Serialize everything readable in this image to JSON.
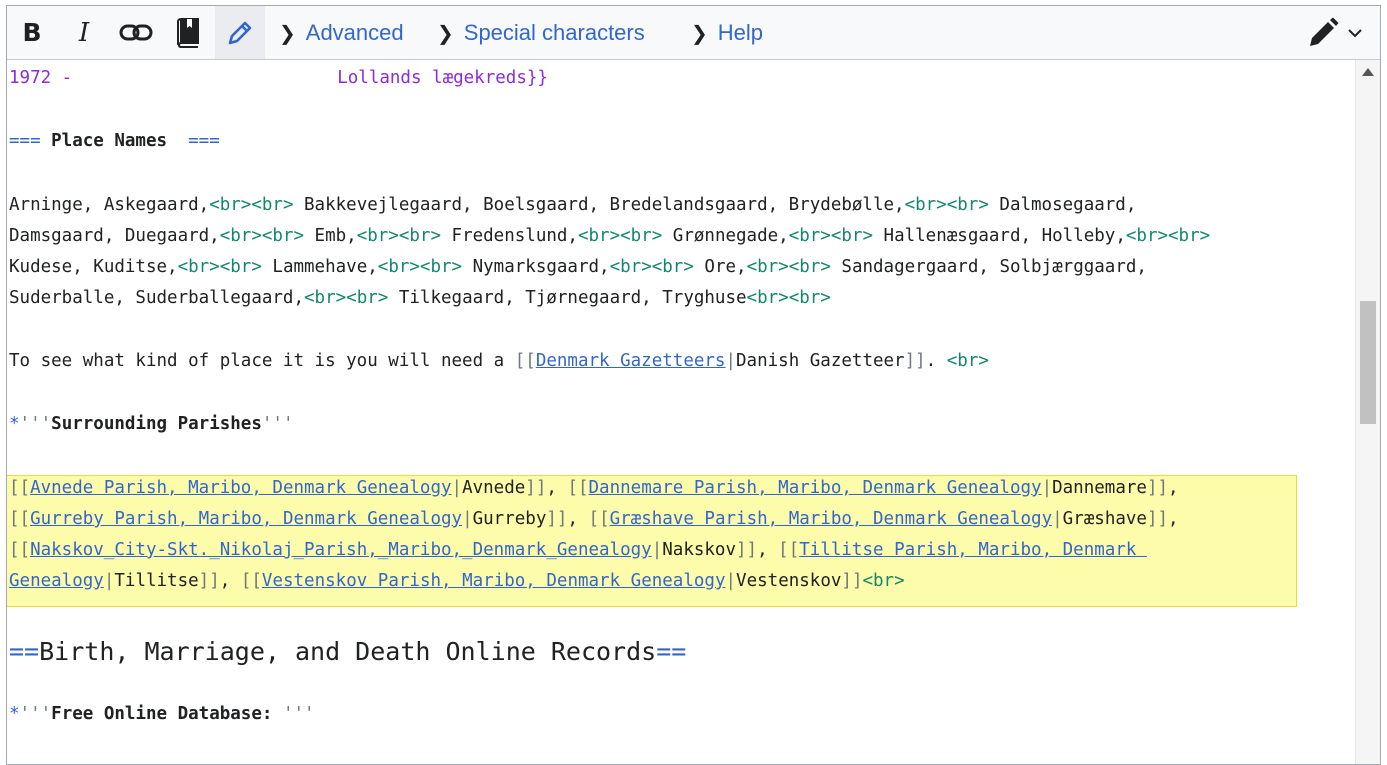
{
  "toolbar": {
    "bold": "B",
    "italic": "I",
    "tabs": [
      "Advanced",
      "Special characters",
      "Help"
    ]
  },
  "editor": {
    "line1_year": "1972 -",
    "line1_rest": "Lollands lægekreds}}",
    "section_eq": "===",
    "section_title": " Place Names  ",
    "p1": {
      "a": "Arninge, Askegaard,",
      "b": " Bakkevejlegaard, Boelsgaard, Bredelandsgaard, Brydebølle,",
      "c": " Dalmosegaard,",
      "d": "Damsgaard, Duegaard,",
      "e": " Emb,",
      "f": " Fredenslund,",
      "g": " Grønnegade,",
      "h": " Hallenæsgaard, Holleby,",
      "i": "Kudese, Kuditse,",
      "j": " Lammehave,",
      "k": " Nymarksgaard,",
      "l": " Ore,",
      "m": " Sandagergaard, Solbjærggaard,",
      "n": "Suderballe, Suderballegaard,",
      "o": " Tilkegaard, Tjørnegaard, Tryghuse"
    },
    "brbr": "<br><br>",
    "br": "<br>",
    "gaz": {
      "before": "To see what kind of place it is you will need a ",
      "open": "[[",
      "link": "Denmark Gazetteers",
      "pipe": "|",
      "label": "Danish Gazetteer",
      "close": "]]",
      "after": ". "
    },
    "bullet": "*",
    "bold_marks": "'''",
    "surrounding": "Surrounding Parishes",
    "parishes": {
      "l1a": "Avnede Parish, Maribo, Denmark Genealogy",
      "l1a_lbl": "Avnede",
      "l1b": "Dannemare Parish, Maribo, Denmark Genealogy",
      "l1b_lbl": "Dannemare",
      "l2a": "Gurreby Parish, Maribo, Denmark Genealogy",
      "l2a_lbl": "Gurreby",
      "l2b": "Græshave Parish, Maribo, Denmark Genealogy",
      "l2b_lbl": "Græshave",
      "l3a": "Nakskov_City-Skt._Nikolaj_Parish,_Maribo,_Denmark_Genealogy",
      "l3a_lbl": "Nakskov",
      "l3b": "Tillitse Parish, Maribo, Denmark ",
      "l4a": "Genealogy",
      "l4a_lbl": "Tillitse",
      "l4b": "Vestenskov Parish, Maribo, Denmark Genealogy",
      "l4b_lbl": "Vestenskov",
      "sep": ", "
    },
    "h2_eq": "==",
    "h2_title": "Birth, Marriage, and Death Online Records",
    "free_db": "Free Online Database: "
  }
}
